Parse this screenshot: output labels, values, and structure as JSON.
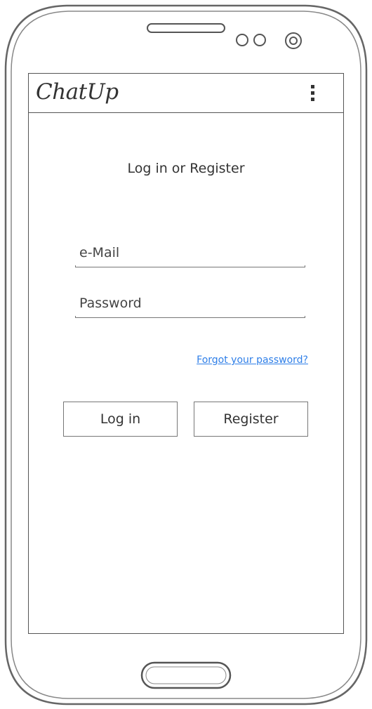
{
  "app": {
    "title": "ChatUp"
  },
  "main": {
    "heading": "Log in or Register",
    "email": {
      "placeholder": "e-Mail",
      "value": ""
    },
    "password": {
      "placeholder": "Password",
      "value": ""
    },
    "forgot_link": "Forgot your password?",
    "login_label": "Log in",
    "register_label": "Register"
  },
  "icons": {
    "menu": "overflow-menu-icon",
    "speaker": "speaker-grille-icon",
    "sensors": "sensor-icon",
    "camera": "front-camera-icon",
    "home": "home-button"
  },
  "colors": {
    "link": "#2f7fe8",
    "outline": "#555555"
  }
}
